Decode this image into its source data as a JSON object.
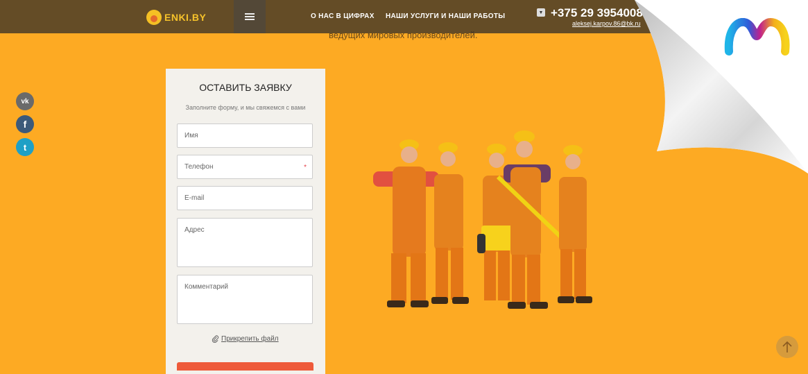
{
  "header": {
    "logo_text": "ENKI.BY",
    "nav": [
      "О НАС В ЦИФРАХ",
      "НАШИ УСЛУГИ И НАШИ РАБОТЫ"
    ],
    "phone": "+375 29 3954008",
    "email": "aleksej.karpov.86@bk.ru"
  },
  "hero_text": {
    "line3": "ведущих мировых производителей."
  },
  "form": {
    "title": "ОСТАВИТЬ ЗАЯВКУ",
    "subtitle": "Заполните форму, и мы свяжемся с вами",
    "fields": [
      {
        "placeholder": "Имя"
      },
      {
        "placeholder": "Телефон",
        "required_mark": "*"
      },
      {
        "placeholder": "E-mail"
      },
      {
        "placeholder": "Адрес"
      },
      {
        "placeholder": "Комментарий"
      }
    ],
    "attach_label": "Прикрепить файл"
  },
  "social": [
    {
      "icon": "vk-icon",
      "glyph": "vk",
      "color": "#6a6a6a"
    },
    {
      "icon": "facebook-icon",
      "glyph": "f",
      "color": "#3c5a7a"
    },
    {
      "icon": "twitter-icon",
      "glyph": "t",
      "color": "#1fa0c6"
    }
  ],
  "colors": {
    "background": "#fdaa23",
    "header": "#3a3a3a",
    "accent_submit": "#ee5a3a",
    "form_bg": "#f3f1ec"
  }
}
